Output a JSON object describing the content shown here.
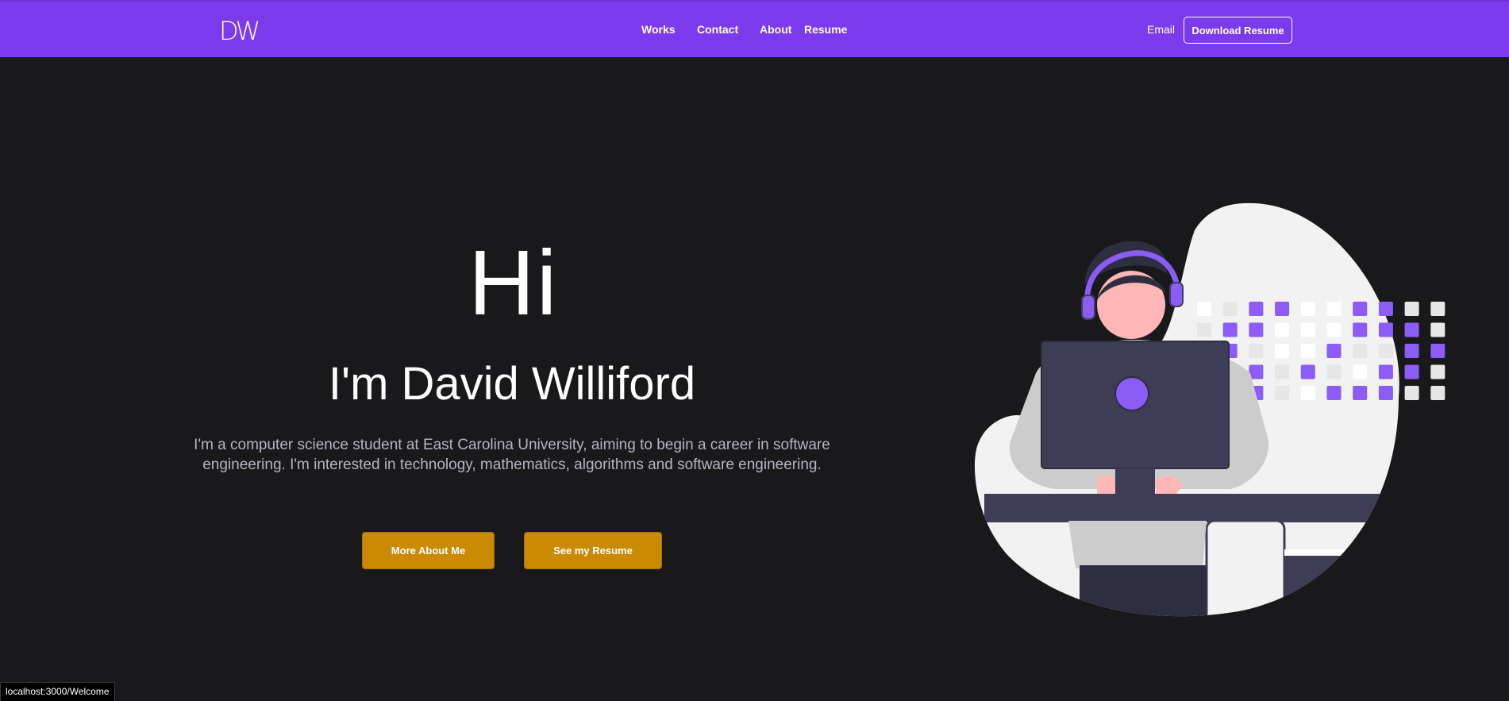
{
  "nav": {
    "logo": "DW",
    "links": [
      "Works",
      "Contact",
      "About",
      "Resume"
    ],
    "email": "Email",
    "download": "Download Resume"
  },
  "hero": {
    "greeting": "Hi",
    "name": "I'm David Williford",
    "intro": "I'm a computer science student at East Carolina University, aiming to begin a career in software engineering. I'm interested in technology, mathematics, algorithms and software engineering.",
    "buttons": [
      "More About Me",
      "See my Resume"
    ]
  },
  "status": {
    "url": "localhost:3000/Welcome"
  },
  "colors": {
    "accent": "#7c3aed",
    "background": "#19191b",
    "button": "#ca8a04",
    "illustration_purple": "#8b5cf6",
    "illustration_dark": "#3f3d56"
  },
  "illustration": {
    "icon": "developer-with-headphones-illustration"
  }
}
